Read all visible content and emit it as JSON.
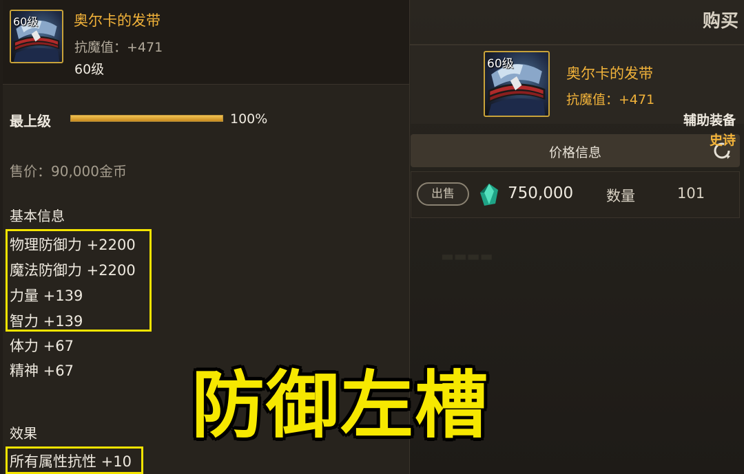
{
  "tooltip": {
    "icon_level": "60级",
    "item_name": "奥尔卡的发带",
    "header_stat": "抗魔值：+471",
    "required_level": "60级",
    "grade_label": "最上级",
    "grade_progress_percent": 100,
    "grade_pct_text": "100%",
    "slot_type": "辅助装备",
    "rarity": "史诗",
    "sell_price": "售价：90,000金币",
    "basic_info_title": "基本信息",
    "attributes": [
      "物理防御力 +2200",
      "魔法防御力 +2200",
      "力量 +139",
      "智力 +139",
      "体力 +67",
      "精神 +67"
    ],
    "effect_title": "效果",
    "effect": "所有属性抗性 +10"
  },
  "shop": {
    "title": "购买",
    "icon_level": "60级",
    "item_name": "奥尔卡的发带",
    "item_stat": "抗魔值：+471",
    "price_info_title": "价格信息",
    "listing": {
      "sell_button": "出售",
      "price": "750,000",
      "qty_label": "数量",
      "qty": "101"
    }
  },
  "caption": "防御左槽",
  "colors": {
    "highlight": "#f4e400",
    "item_name": "#f2b33a",
    "caption": "#f6e800"
  }
}
